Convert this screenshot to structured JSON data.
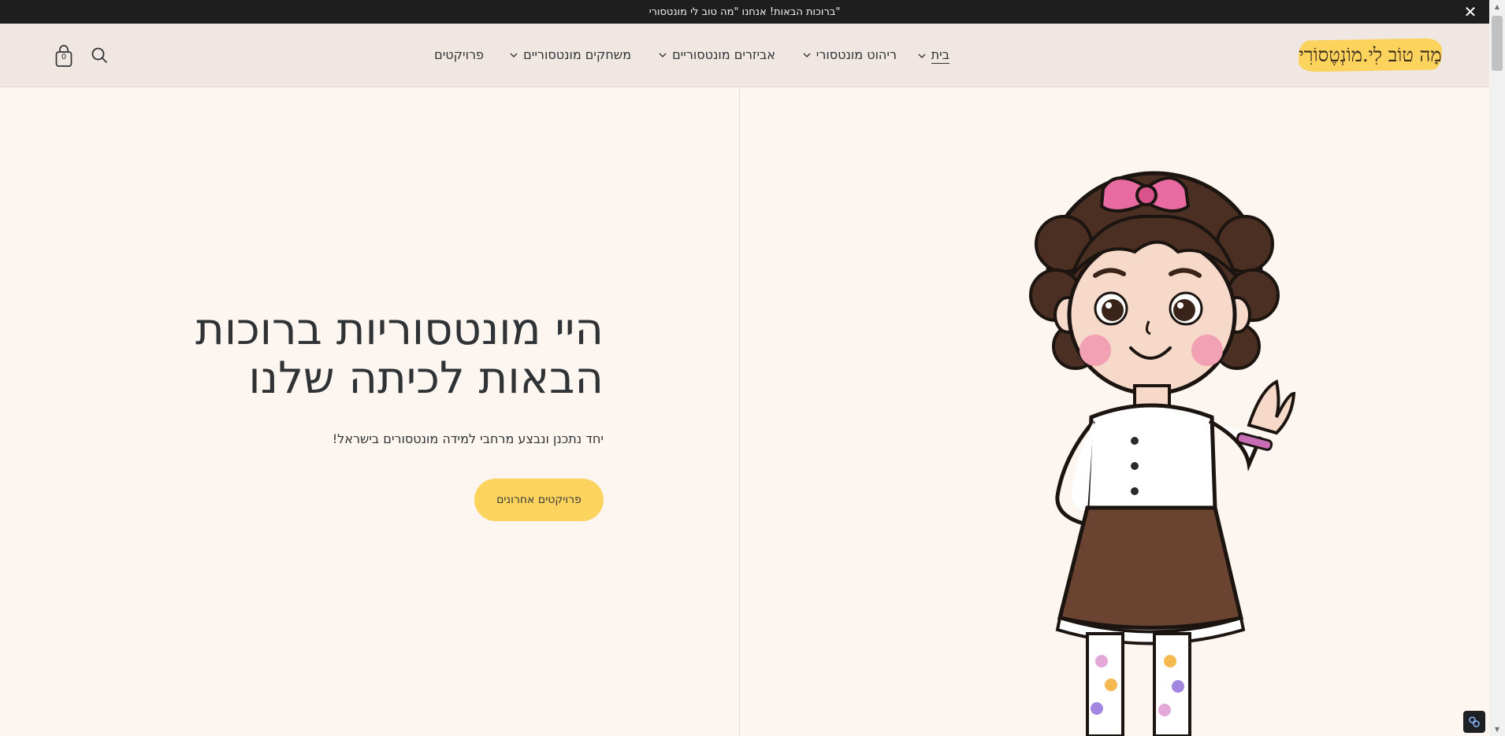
{
  "announcement": {
    "text": "ברוכות הבאות! אנחנו \"מה טוב לי מונטסורי\"",
    "close_label": "✕"
  },
  "header": {
    "logo_text": "מָה טוֹב לִי.מוֹנְטֶסוֹרִי",
    "nav": [
      {
        "label": "בית",
        "has_dropdown": true,
        "active": true
      },
      {
        "label": "ריהוט מונטסורי",
        "has_dropdown": true
      },
      {
        "label": "אביזרים מונטסוריים",
        "has_dropdown": true
      },
      {
        "label": "משחקים מונטסוריים",
        "has_dropdown": true
      },
      {
        "label": "פרויקטים",
        "has_dropdown": false
      }
    ],
    "cart_count": "0",
    "icons": [
      "search-icon",
      "cart-icon"
    ]
  },
  "hero": {
    "title_line1": "היי מונטסוריות ברוכות",
    "title_line2": "הבאות לכיתה שלנו",
    "subtitle": "יחד נתכנן ונבצע מרחבי למידה מונטסורים בישראל!",
    "button_label": "פרויקטים אחרונים"
  },
  "colors": {
    "background": "#fdf5f0",
    "header_bg": "#f0e6e2",
    "announcement_bg": "#1e1e1e",
    "accent_yellow": "#fcd35d",
    "text_dark": "#2f3336"
  }
}
